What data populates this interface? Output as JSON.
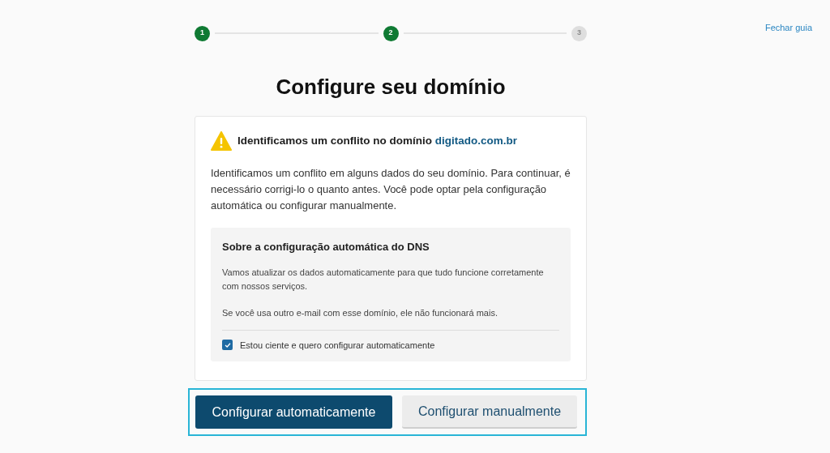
{
  "close_link": "Fechar guia",
  "steps": [
    {
      "label": "1",
      "completed": true
    },
    {
      "label": "2",
      "completed": true
    },
    {
      "label": "3",
      "completed": false
    }
  ],
  "title": "Configure seu domínio",
  "alert": {
    "heading": "Identificamos um conflito no domínio",
    "domain": "digitado.com.br",
    "body": "Identificamos um conflito em alguns dados do seu domínio. Para continuar, é necessário corrigi-lo o quanto antes. Você pode optar pela configuração automática ou configurar manualmente."
  },
  "info": {
    "heading": "Sobre a configuração automática do DNS",
    "paragraphs": [
      "Vamos atualizar os dados automaticamente para que tudo funcione corretamente com nossos serviços.",
      "Se você usa outro e-mail com esse domínio, ele não funcionará mais."
    ],
    "checkbox": {
      "label": "Estou ciente e quero configurar automaticamente",
      "checked": true
    }
  },
  "buttons": [
    {
      "label": "Configurar automaticamente",
      "kind": "primary"
    },
    {
      "label": "Configurar manualmente",
      "kind": "secondary"
    }
  ]
}
